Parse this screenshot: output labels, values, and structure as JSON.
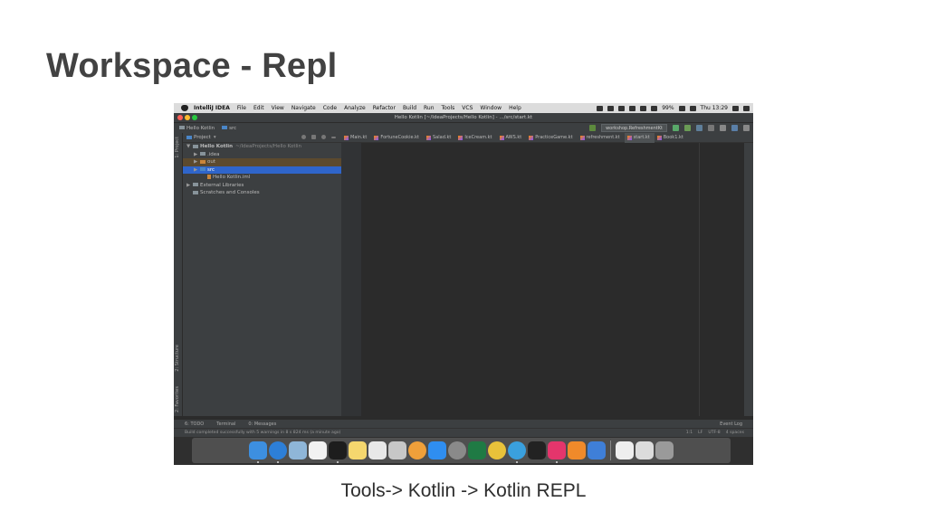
{
  "slide": {
    "title": "Workspace - Repl",
    "caption": "Tools-> Kotlin -> Kotlin REPL"
  },
  "menubar": {
    "app_name": "IntelliJ IDEA",
    "items": [
      "File",
      "Edit",
      "View",
      "Navigate",
      "Code",
      "Analyze",
      "Refactor",
      "Build",
      "Run",
      "Tools",
      "VCS",
      "Window",
      "Help"
    ],
    "battery": "99%",
    "clock": "Thu 13:29"
  },
  "window": {
    "title": "Hello Kotlin [~/IdeaProjects/Hello Kotlin] - .../src/start.kt"
  },
  "navbar": {
    "crumbs": [
      "Hello Kotlin",
      "src"
    ],
    "run_config": "workshop.RefreshmentKt"
  },
  "side_labels": {
    "project": "1: Project",
    "structure": "2: Structure",
    "favorites": "2: Favorites"
  },
  "project_panel": {
    "dropdown_label": "Project",
    "tree": [
      {
        "label": "Hello Kotlin",
        "hint": "~/IdeaProjects/Hello Kotlin",
        "indent": 0,
        "arrow": "▼",
        "folder": true
      },
      {
        "label": ".idea",
        "hint": "",
        "indent": 1,
        "arrow": "▶",
        "folder": true
      },
      {
        "label": "out",
        "hint": "",
        "indent": 1,
        "arrow": "▶",
        "folder": true
      },
      {
        "label": "src",
        "hint": "",
        "indent": 1,
        "arrow": "▶",
        "folder": true
      },
      {
        "label": "Hello Kotlin.iml",
        "hint": "",
        "indent": 2,
        "arrow": "",
        "folder": false
      },
      {
        "label": "External Libraries",
        "hint": "",
        "indent": 0,
        "arrow": "▶",
        "folder": true
      },
      {
        "label": "Scratches and Consoles",
        "hint": "",
        "indent": 0,
        "arrow": "",
        "folder": true
      }
    ]
  },
  "editor_tabs": [
    "Main.kt",
    "FortuneCookie.kt",
    "Salad.kt",
    "IceCream.kt",
    "AWS.kt",
    "PracticeGame.kt",
    "refreshment.kt",
    "start.kt",
    "Book1.kt"
  ],
  "active_tab": "start.kt",
  "bottom_tools": {
    "todo": "6: TODO",
    "terminal": "Terminal",
    "messages": "0: Messages",
    "event_log": "Event Log"
  },
  "status": {
    "message": "Build completed successfully with 5 warnings in 8 s 824 ms (a minute ago)",
    "position": "1:1",
    "line_sep": "LF",
    "encoding": "UTF-8",
    "indent": "4 spaces"
  },
  "dock": {
    "apps": [
      {
        "icon": "finder-icon",
        "color": "#3d8fe0"
      },
      {
        "icon": "safari-icon",
        "color": "#2d7fd8"
      },
      {
        "icon": "preview-icon",
        "color": "#8fb6d8"
      },
      {
        "icon": "calendar-icon",
        "color": "#f2f2f2"
      },
      {
        "icon": "terminal-icon",
        "color": "#1d1d1d"
      },
      {
        "icon": "notes-icon",
        "color": "#f5d76e"
      },
      {
        "icon": "textedit-icon",
        "color": "#e8e8e8"
      },
      {
        "icon": "script-editor-icon",
        "color": "#c7c7c7"
      },
      {
        "icon": "photos-icon",
        "color": "#f0a03a"
      },
      {
        "icon": "app-store-icon",
        "color": "#2f8ef0"
      },
      {
        "icon": "system-preferences-icon",
        "color": "#8a8a8a"
      },
      {
        "icon": "excel-icon",
        "color": "#1f7a44"
      },
      {
        "icon": "chrome-icon",
        "color": "#e8c23a"
      },
      {
        "icon": "telegram-icon",
        "color": "#3aa0de"
      },
      {
        "icon": "activity-monitor-icon",
        "color": "#222222"
      },
      {
        "icon": "intellij-icon",
        "color": "#e4356c"
      },
      {
        "icon": "ibooks-icon",
        "color": "#f08a2a"
      },
      {
        "icon": "quicktime-icon",
        "color": "#3f7fd8"
      },
      {
        "icon": "document-icon",
        "color": "#eeeeee"
      },
      {
        "icon": "screen-icon",
        "color": "#dcdcdc"
      },
      {
        "icon": "trash-icon",
        "color": "#9a9a9a"
      }
    ]
  }
}
